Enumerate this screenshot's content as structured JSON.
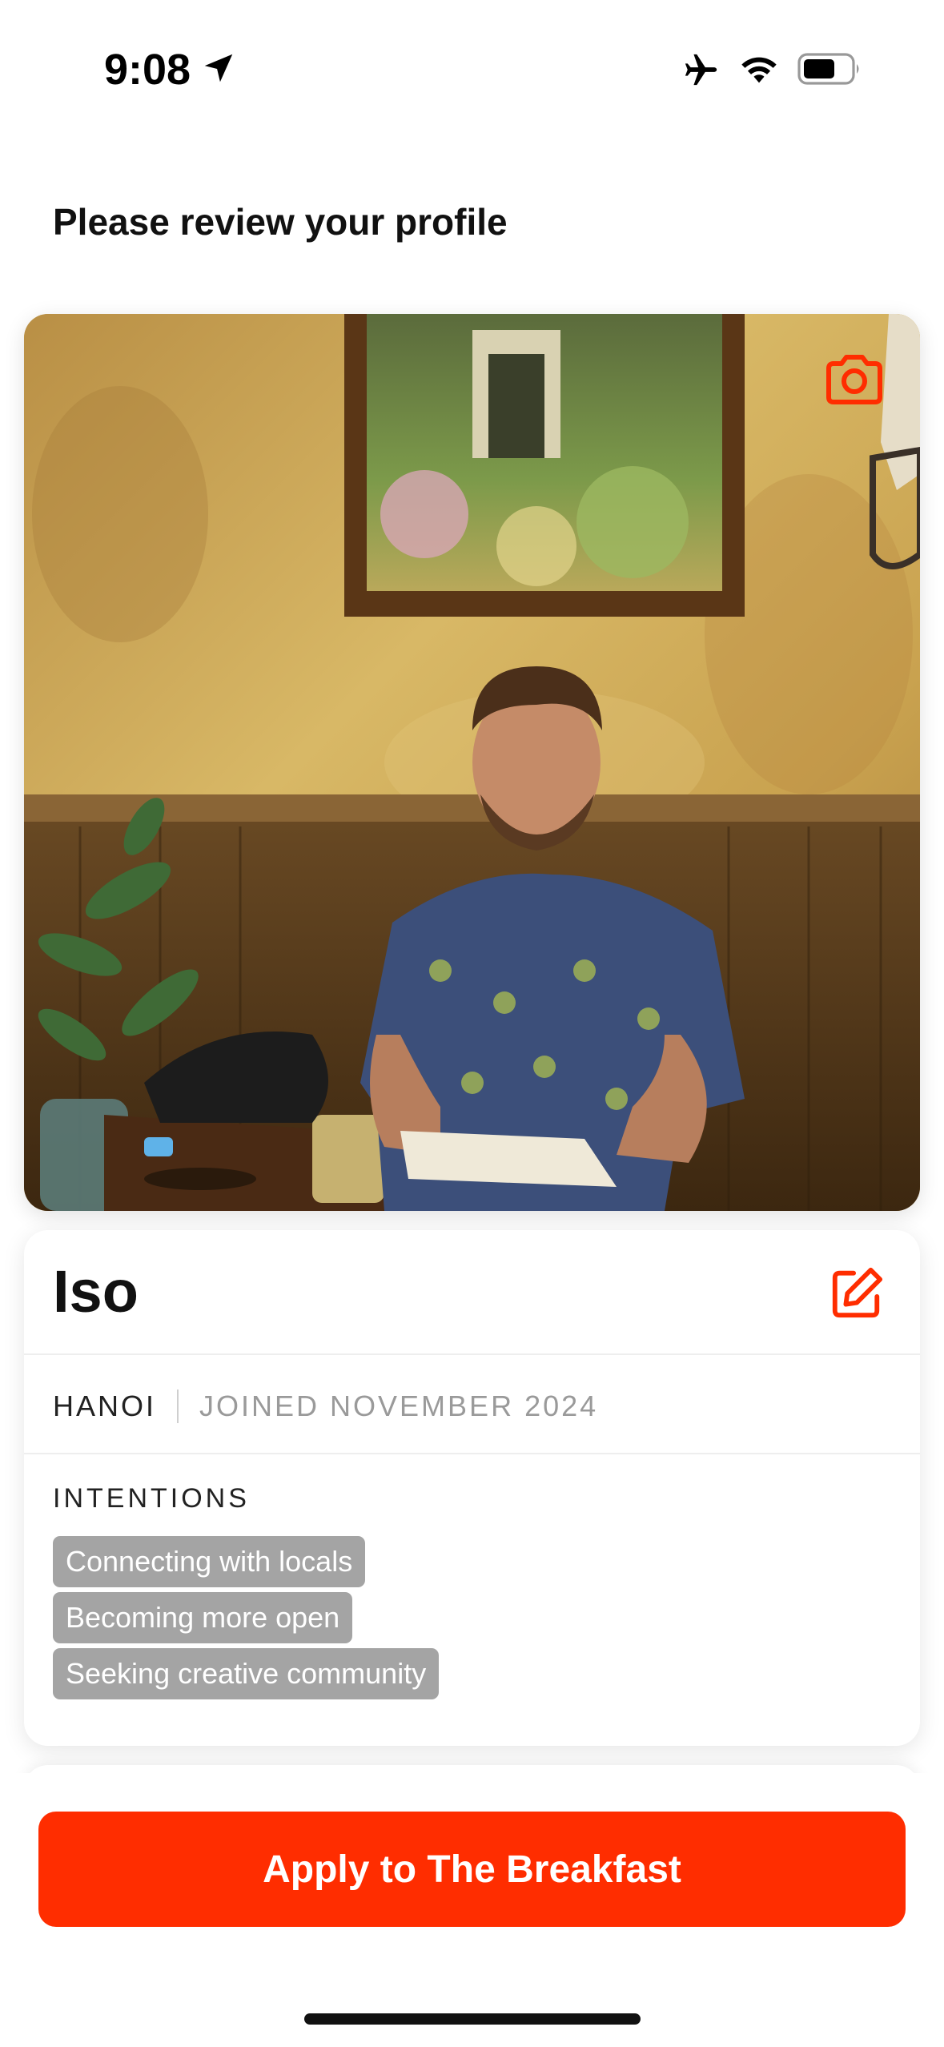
{
  "status_bar": {
    "time": "9:08",
    "icons": [
      "location-arrow-icon",
      "airplane-mode-icon",
      "wifi-icon",
      "battery-icon"
    ]
  },
  "header": {
    "title": "Please review your profile"
  },
  "photo": {
    "edit_icon": "camera-icon"
  },
  "profile": {
    "name": "Iso",
    "edit_icon": "edit-icon",
    "city": "HANOI",
    "joined": "JOINED NOVEMBER 2024",
    "intentions_label": "INTENTIONS",
    "intentions": [
      "Connecting with locals",
      "Becoming more open",
      "Seeking creative community"
    ]
  },
  "footer": {
    "apply_label": "Apply to The Breakfast"
  },
  "colors": {
    "accent": "#ff2d00",
    "chip_bg": "#a4a4a4",
    "muted_text": "#9a9a9a"
  }
}
